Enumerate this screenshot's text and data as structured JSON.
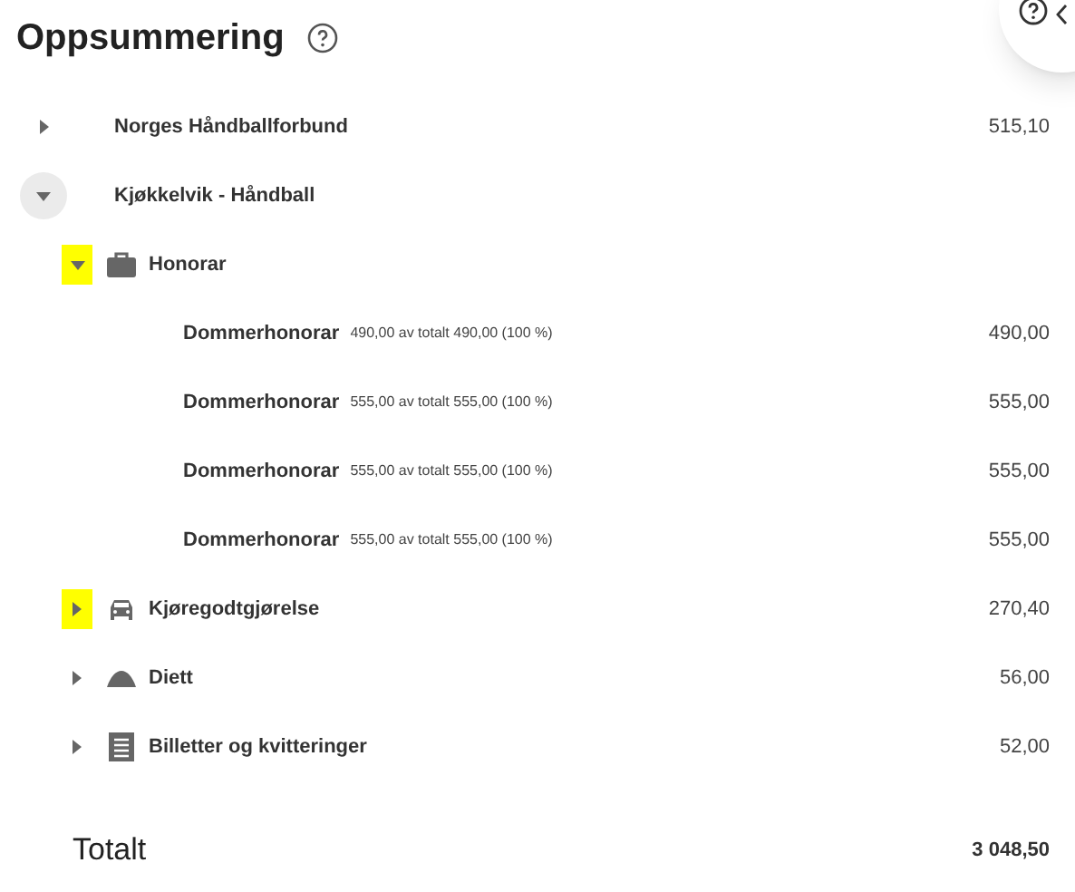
{
  "title": "Oppsummering",
  "tree": [
    {
      "label": "Norges Håndballforbund",
      "amount": "515,10",
      "expanded": false,
      "hovered": false
    },
    {
      "label": "Kjøkkelvik - Håndball",
      "expanded": true,
      "hovered": true,
      "children": [
        {
          "label": "Honorar",
          "kind": "briefcase",
          "expanded": true,
          "highlighted": true,
          "children": [
            {
              "label": "Dommerhonorar",
              "detail": "490,00 av totalt 490,00 (100 %)",
              "amount": "490,00"
            },
            {
              "label": "Dommerhonorar",
              "detail": "555,00 av totalt 555,00 (100 %)",
              "amount": "555,00"
            },
            {
              "label": "Dommerhonorar",
              "detail": "555,00 av totalt 555,00 (100 %)",
              "amount": "555,00"
            },
            {
              "label": "Dommerhonorar",
              "detail": "555,00 av totalt 555,00 (100 %)",
              "amount": "555,00"
            }
          ]
        },
        {
          "label": "Kjøregodtgjørelse",
          "kind": "car",
          "amount": "270,40",
          "expanded": false,
          "highlighted": true
        },
        {
          "label": "Diett",
          "kind": "dome",
          "amount": "56,00",
          "expanded": false,
          "highlighted": false
        },
        {
          "label": "Billetter og kvitteringer",
          "kind": "receipt",
          "amount": "52,00",
          "expanded": false,
          "highlighted": false
        }
      ]
    }
  ],
  "total": {
    "label": "Totalt",
    "amount": "3 048,50"
  }
}
